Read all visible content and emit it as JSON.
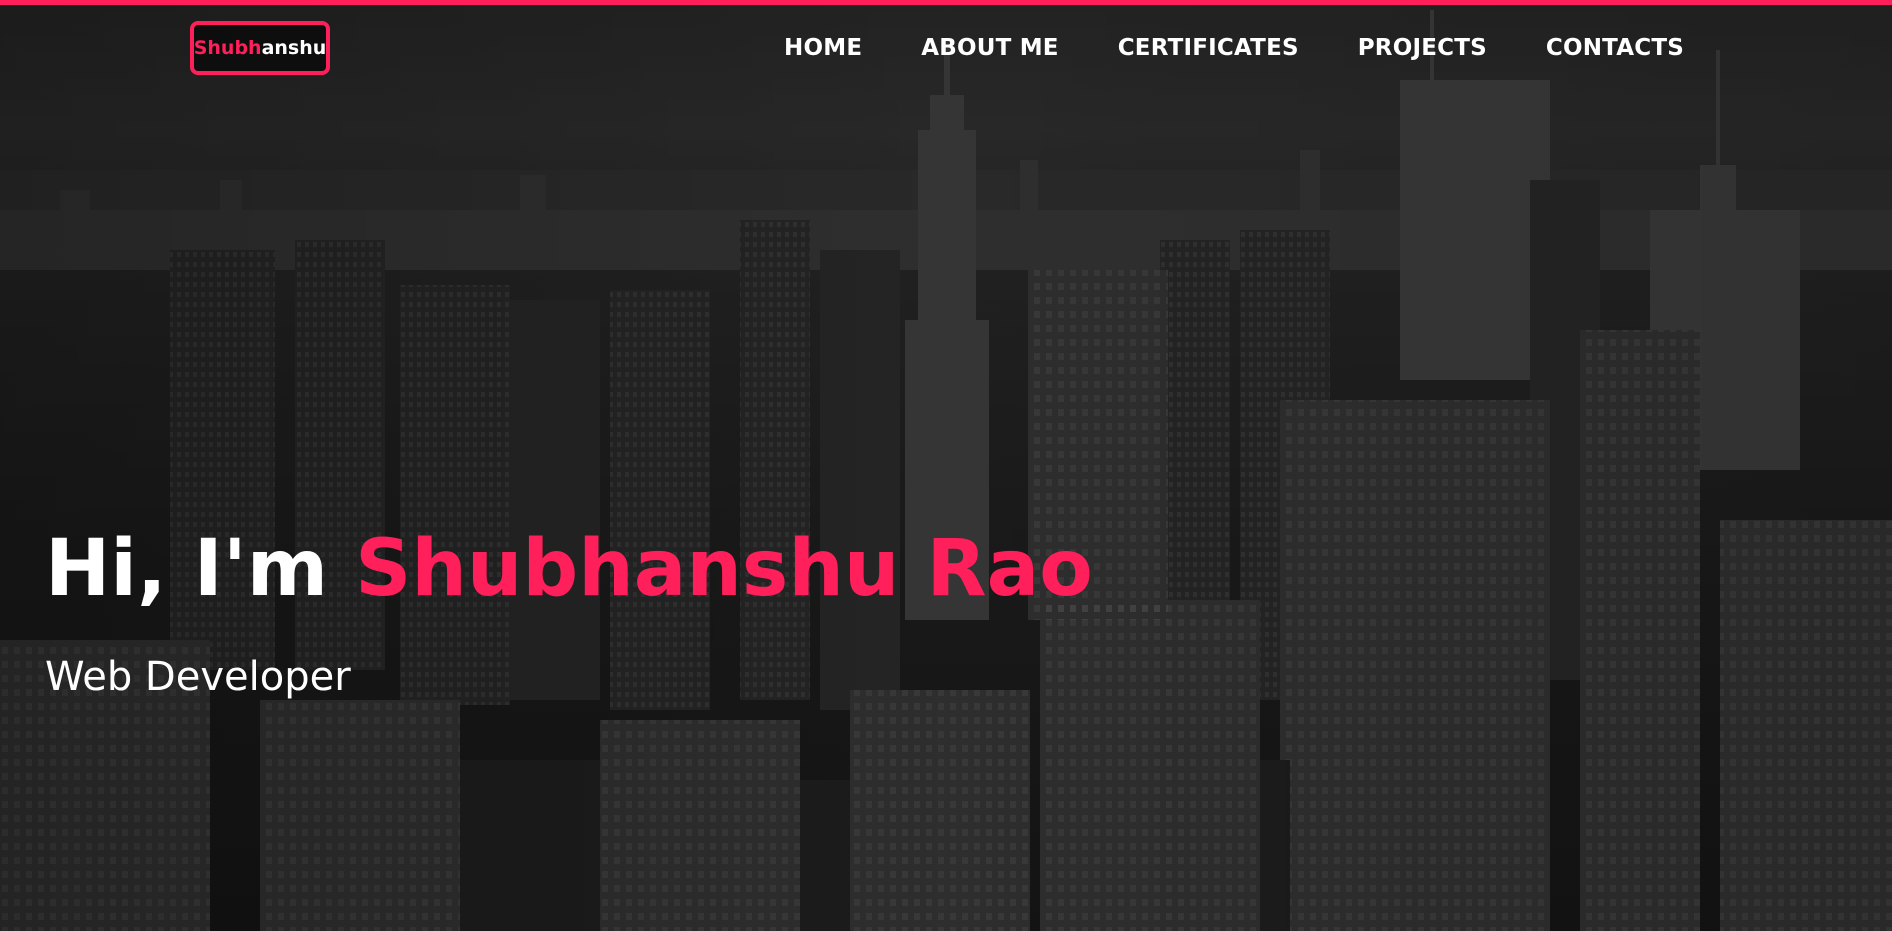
{
  "colors": {
    "accent": "#ff1f5a",
    "text": "#ffffff",
    "background": "#1b1b1b"
  },
  "navbar": {
    "logo": {
      "accent_part": "Shubh",
      "rest_part": "anshu"
    },
    "links": [
      {
        "label": "HOME"
      },
      {
        "label": "ABOUT ME"
      },
      {
        "label": "CERTIFICATES"
      },
      {
        "label": "PROJECTS"
      },
      {
        "label": "CONTACTS"
      }
    ]
  },
  "hero": {
    "greeting": "Hi, I'm ",
    "name": "Shubhanshu Rao",
    "role": "Web Developer"
  }
}
